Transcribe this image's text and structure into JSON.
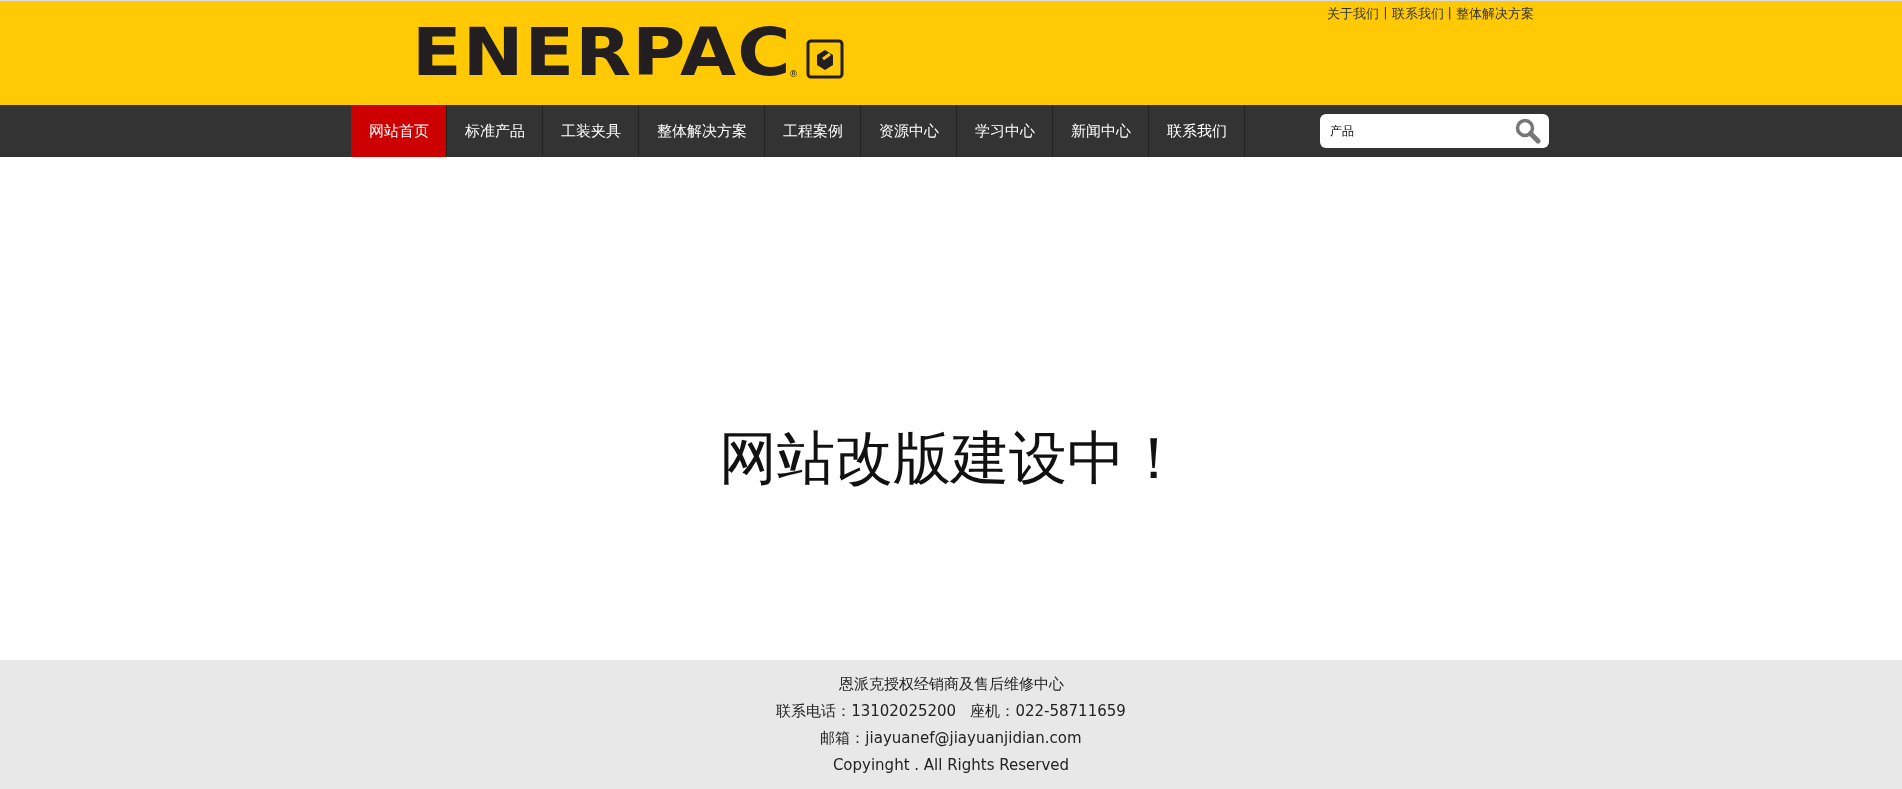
{
  "top_links": [
    "关于我们",
    "|",
    "联系我们",
    "|",
    "整体解决方案"
  ],
  "logo": {
    "text": "ENERPAC",
    "mark": "®"
  },
  "nav": [
    {
      "label": "网站首页",
      "selected": true
    },
    {
      "label": "标准产品",
      "selected": false
    },
    {
      "label": "工装夹具",
      "selected": false
    },
    {
      "label": "整体解决方案",
      "selected": false
    },
    {
      "label": "工程案例",
      "selected": false
    },
    {
      "label": "资源中心",
      "selected": false
    },
    {
      "label": "学习中心",
      "selected": false
    },
    {
      "label": "新闻中心",
      "selected": false
    },
    {
      "label": "联系我们",
      "selected": false
    }
  ],
  "search": {
    "value": "产品"
  },
  "main": {
    "heading": "网站改版建设中！"
  },
  "footer": {
    "lines": [
      "恩派克授权经销商及售后维修中心",
      "联系电话：13102025200   座机：022-58711659",
      "邮箱：jiayuanef@jiayuanjidian.com",
      "Copyinght . All Rights Reserved"
    ]
  }
}
